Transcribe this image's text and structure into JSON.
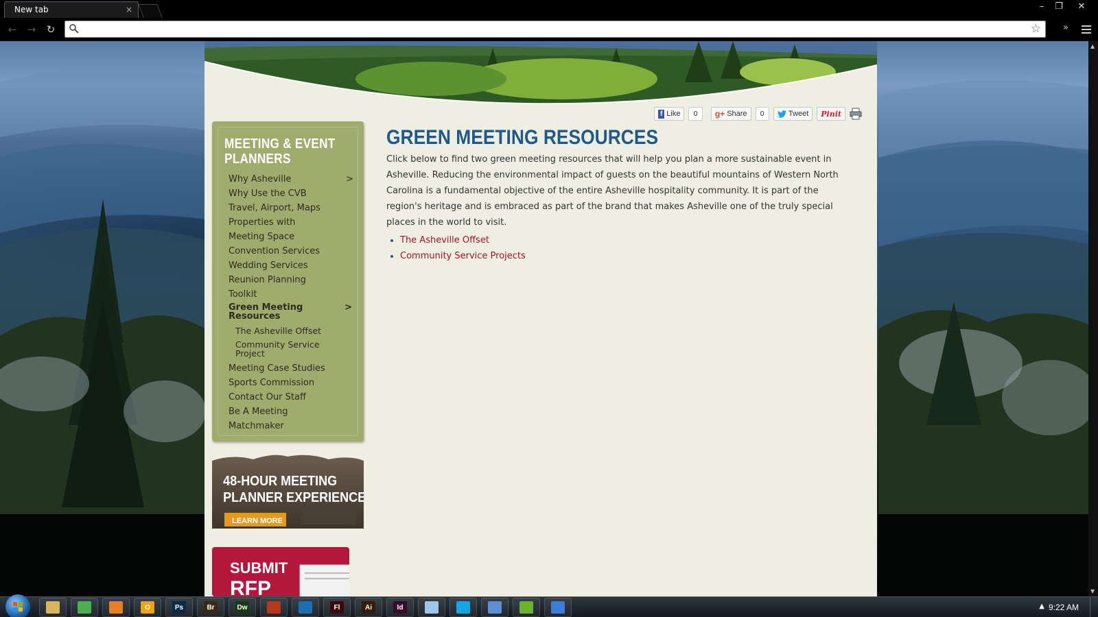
{
  "browser": {
    "tab_title": "New tab",
    "tab_close": "×",
    "window_controls": [
      "–",
      "❐",
      "✕"
    ],
    "nav_back": "←",
    "nav_forward": "→",
    "nav_reload": "↻",
    "omnibox_value": "",
    "star": "☆",
    "chevron": "»"
  },
  "share": {
    "facebook_label": "Like",
    "facebook_icon": "f",
    "facebook_count": "0",
    "gplus_icon": "g+",
    "gplus_label": "Share",
    "gplus_count": "0",
    "twitter_label": "Tweet",
    "pinterest_label": "Pinit",
    "print_icon": "print-icon"
  },
  "sidebar": {
    "title": "MEETING & EVENT PLANNERS",
    "items": [
      {
        "label": "Why Asheville",
        "arrow": ">"
      },
      {
        "label": "Why Use the CVB"
      },
      {
        "label": "Travel, Airport, Maps"
      },
      {
        "label": "Properties with"
      },
      {
        "label": "Meeting Space"
      },
      {
        "label": "Convention Services"
      },
      {
        "label": "Wedding Services"
      },
      {
        "label": "Reunion Planning"
      },
      {
        "label": "Toolkit"
      }
    ],
    "active": {
      "label": "Green Meeting Resources",
      "arrow": ">"
    },
    "subitems": [
      {
        "label": "The Asheville Offset"
      },
      {
        "label": "Community Service Project"
      }
    ],
    "items_after": [
      {
        "label": "Meeting Case Studies"
      },
      {
        "label": "Sports Commission"
      },
      {
        "label": "Contact Our Staff"
      },
      {
        "label": "Be A Meeting"
      },
      {
        "label": "Matchmaker"
      }
    ]
  },
  "promo1": {
    "line1": "48-HOUR MEETING",
    "line2": "PLANNER EXPERIENCE",
    "button": "LEARN MORE"
  },
  "promo2": {
    "line1": "SUBMIT",
    "line2": "RFP"
  },
  "main": {
    "title": "GREEN MEETING RESOURCES",
    "body": "Click below to find two green meeting resources that will help you plan a more sustainable event in Asheville. Reducing the environmental impact of guests on the beautiful mountains of Western North Carolina is a fundamental objective of the entire Asheville hospitality community. It is part of the region's heritage and is embraced as part of the brand that makes Asheville one of the truly special places in the world to visit.",
    "links": [
      "The Asheville Offset",
      "Community Service Projects"
    ]
  },
  "taskbar": {
    "apps": [
      {
        "icon": "folder-icon",
        "label": "",
        "bg": "#d9b45a"
      },
      {
        "icon": "chrome-icon",
        "label": "",
        "bg": "#4caf50"
      },
      {
        "icon": "firefox-icon",
        "label": "",
        "bg": "#e67e22"
      },
      {
        "icon": "outlook-icon",
        "label": "O",
        "bg": "#f0a30a"
      },
      {
        "icon": "photoshop-icon",
        "label": "Ps",
        "bg": "#0a2a4a"
      },
      {
        "icon": "bridge-icon",
        "label": "Br",
        "bg": "#3a2a10"
      },
      {
        "icon": "dreamweaver-icon",
        "label": "Dw",
        "bg": "#1a3a10"
      },
      {
        "icon": "filezilla-icon",
        "label": "",
        "bg": "#b23a1a"
      },
      {
        "icon": "messenger-icon",
        "label": "",
        "bg": "#1c6fb5"
      },
      {
        "icon": "flash-icon",
        "label": "Fl",
        "bg": "#3a0a0a"
      },
      {
        "icon": "illustrator-icon",
        "label": "Ai",
        "bg": "#3a1a00"
      },
      {
        "icon": "indesign-icon",
        "label": "Id",
        "bg": "#3a0a2a"
      },
      {
        "icon": "notepad-icon",
        "label": "",
        "bg": "#9fc5e8"
      },
      {
        "icon": "skype-icon",
        "label": "",
        "bg": "#12a5e8"
      },
      {
        "icon": "itunes-icon",
        "label": "",
        "bg": "#5b8fd6"
      },
      {
        "icon": "spotify-icon",
        "label": "",
        "bg": "#6ab42d"
      },
      {
        "icon": "window-icon",
        "label": "",
        "bg": "#3b7dd8"
      }
    ],
    "tray": "▲",
    "clock": "9:22 AM"
  }
}
